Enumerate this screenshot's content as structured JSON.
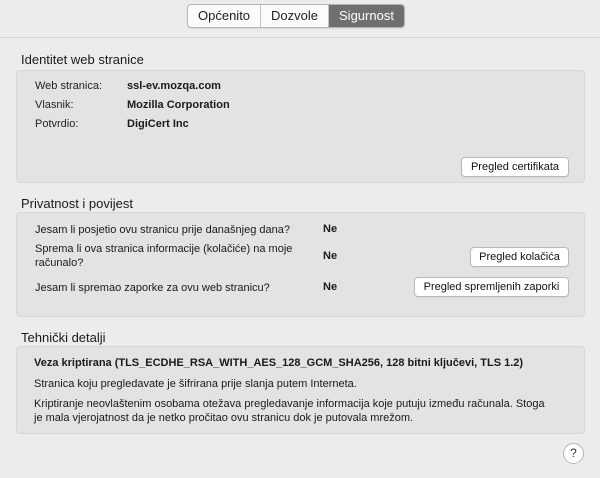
{
  "tabs": [
    "Općenito",
    "Dozvole",
    "Sigurnost"
  ],
  "identity": {
    "title": "Identitet web stranice",
    "website_label": "Web stranica:",
    "website_value": "ssl-ev.mozqa.com",
    "owner_label": "Vlasnik:",
    "owner_value": "Mozilla Corporation",
    "verified_label": "Potvrdio:",
    "verified_value": "DigiCert Inc",
    "view_cert_button": "Pregled certifikata"
  },
  "privacy": {
    "title": "Privatnost i povijest",
    "q1": "Jesam li posjetio ovu stranicu prije današnjeg dana?",
    "a1": "Ne",
    "q2_line1": "Sprema li ova stranica informacije (kolačiće) na moje",
    "q2_line2": "računalo?",
    "a2": "Ne",
    "cookies_button": "Pregled kolačića",
    "q3": "Jesam li spremao zaporke za ovu web stranicu?",
    "a3": "Ne",
    "passwords_button": "Pregled spremljenih zaporki"
  },
  "technical": {
    "title": "Tehnički detalji",
    "connection": "Veza kriptirana (TLS_ECDHE_RSA_WITH_AES_128_GCM_SHA256, 128 bitni ključevi, TLS 1.2)",
    "text1": "Stranica koju pregledavate je šifrirana prije slanja putem Interneta.",
    "text2_line1": "Kriptiranje neovlaštenim osobama otežava pregledavanje informacija koje putuju između računala. Stoga",
    "text2_line2": "je mala vjerojatnost da je netko pročitao ovu stranicu dok je putovala mrežom."
  },
  "help_label": "?"
}
